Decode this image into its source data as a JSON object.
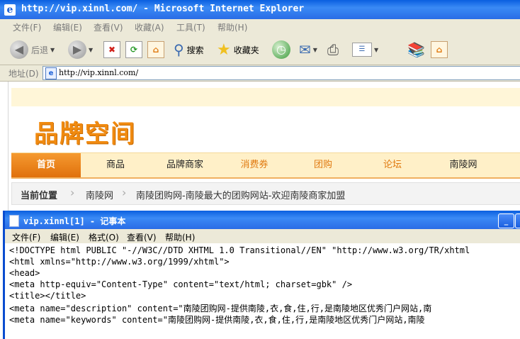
{
  "ie": {
    "title": "http://vip.xinnl.com/ - Microsoft Internet Explorer",
    "menu": [
      "文件(F)",
      "编辑(E)",
      "查看(V)",
      "收藏(A)",
      "工具(T)",
      "帮助(H)"
    ],
    "toolbar": {
      "back": "后退",
      "search": "搜索",
      "favorites": "收藏夹"
    },
    "address_label": "地址(D)",
    "address_value": "http://vip.xinnl.com/"
  },
  "site": {
    "logo": "品牌空间",
    "nav": [
      "首页",
      "商品",
      "品牌商家",
      "消费券",
      "团购",
      "论坛",
      "南陵网"
    ],
    "breadcrumb": {
      "current_label": "当前位置",
      "items": [
        "南陵网",
        "南陵团购网-南陵最大的团购网站-欢迎南陵商家加盟"
      ]
    },
    "colors": {
      "accent": "#f08a10",
      "nav_active": "#e0700c"
    }
  },
  "notepad": {
    "title": "vip.xinnl[1] - 记事本",
    "menu": [
      "文件(F)",
      "编辑(E)",
      "格式(O)",
      "查看(V)",
      "帮助(H)"
    ],
    "lines": [
      "<!DOCTYPE html PUBLIC \"-//W3C//DTD XHTML 1.0 Transitional//EN\" \"http://www.w3.org/TR/xhtml",
      "<html xmlns=\"http://www.w3.org/1999/xhtml\">",
      "<head>",
      "<meta http-equiv=\"Content-Type\" content=\"text/html; charset=gbk\" />",
      "<title></title>",
      "<meta name=\"description\" content=\"南陵团购网-提供南陵,衣,食,住,行,是南陵地区优秀门户网站,南",
      "<meta name=\"keywords\" content=\"南陵团购网-提供南陵,衣,食,住,行,是南陵地区优秀门户网站,南陵"
    ]
  }
}
